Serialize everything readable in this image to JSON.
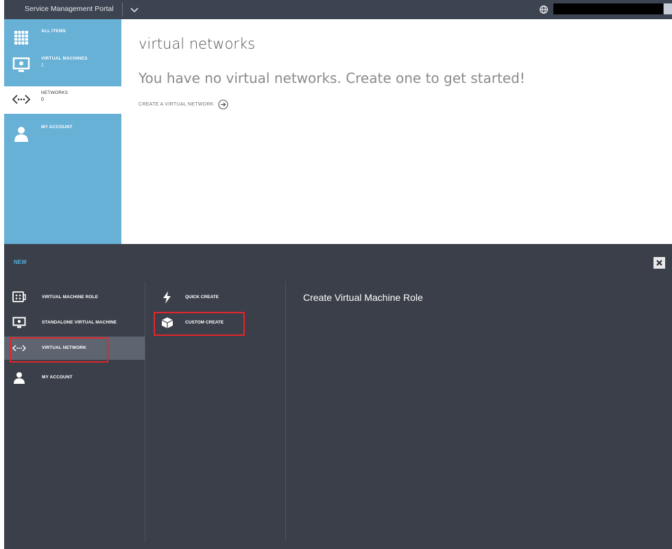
{
  "topbar": {
    "app_title": "Service Management Portal"
  },
  "sidebar": {
    "items": [
      {
        "label": "ALL ITEMS",
        "count": "",
        "icon": "grid-icon"
      },
      {
        "label": "VIRTUAL MACHINES",
        "count": "1",
        "icon": "monitor-icon"
      },
      {
        "label": "NETWORKS",
        "count": "0",
        "icon": "network-icon"
      },
      {
        "label": "MY ACCOUNT",
        "count": "",
        "icon": "person-icon"
      }
    ]
  },
  "main": {
    "title": "virtual networks",
    "empty_message": "You have no virtual networks. Create one to get started!",
    "create_link": "CREATE A VIRTUAL NETWORK"
  },
  "new_drawer": {
    "title": "NEW",
    "categories": [
      {
        "label": "VIRTUAL MACHINE ROLE",
        "icon": "vm-role-icon"
      },
      {
        "label": "STANDALONE VIRTUAL MACHINE",
        "icon": "monitor-icon"
      },
      {
        "label": "VIRTUAL NETWORK",
        "icon": "network-icon"
      },
      {
        "label": "MY ACCOUNT",
        "icon": "person-icon"
      }
    ],
    "selected_category": "VIRTUAL NETWORK",
    "methods": [
      {
        "label": "QUICK CREATE",
        "icon": "lightning-icon"
      },
      {
        "label": "CUSTOM CREATE",
        "icon": "box-icon"
      }
    ],
    "description_title": "Create Virtual Machine Role"
  },
  "colors": {
    "topbar": "#3c4452",
    "sidebar": "#67b0d6",
    "drawer": "#3a3f49",
    "accent": "#4fb0e0",
    "highlight": "#e0262d"
  }
}
